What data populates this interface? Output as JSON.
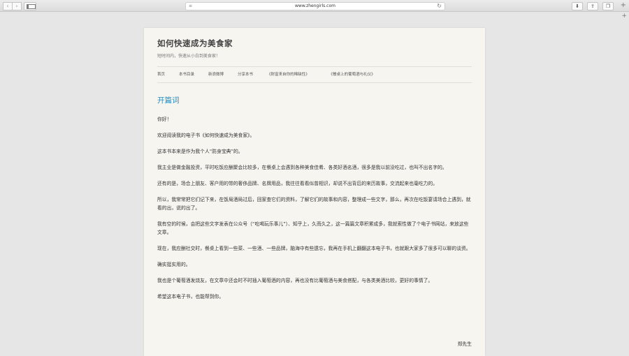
{
  "browser": {
    "url": "www.zhengirls.com",
    "back_glyph": "‹",
    "forward_glyph": "›",
    "address_menu_glyph": "≡",
    "reload_glyph": "↻",
    "download_glyph": "⬇",
    "share_glyph": "⇪",
    "tabs_glyph": "❐",
    "new_tab_glyph": "+",
    "icons": [
      "back-icon",
      "forward-icon",
      "sidebar-icon",
      "reader-icon",
      "reload-icon",
      "download-icon",
      "share-icon",
      "tabs-icon",
      "plus-icon"
    ]
  },
  "site": {
    "title": "如何快速成为美食家",
    "description": "短时间内，快速从小白到美食家！"
  },
  "menu": [
    {
      "label": "首页"
    },
    {
      "label": "本书目录"
    },
    {
      "label": "新浪微博"
    },
    {
      "label": "分享本书"
    },
    {
      "label": "《财富来自你的稀缺性》"
    },
    {
      "label": "《餐桌上的葡萄酒与礼仪》"
    }
  ],
  "article": {
    "title": "开篇词",
    "paragraphs": [
      "你好！",
      "欢迎阅读我的电子书《如何快速成为美食家》。",
      "这本书本来是作为我个人“防身宝典”的。",
      "我主业是做金融投资，平时吃饭应酬聚会比较多，在餐桌上会遇到各种美食佳肴、各类好酒名酒，很多是我以前没吃过，也叫不出名字的。",
      "还有的是，场合上朋友、客户用的带的奢侈品牌、名牌用品，我往往看看似曾相识，却说不出背后的来历故事，交流起来也毫吃力的。",
      "所以，我常常把它们记下来，在饭局酒局过后，回家查它们的资料，了解它们的故事和内容，整理成一些文字，那么，再次在吃饭宴请场合上遇到，就看的出，说的出了。",
      "我有空的时候，会把这些文字发表在公众号（“吃喝玩乐事儿”）、知乎上，久而久之，这一篇篇文章积累成多，我就索性做了个电子书网站，来放这些文章。",
      "现在，我应酬社交时，餐桌上看到一些菜、一些酒、一些品牌，脑海中有些遗忘，我再在手机上翻翻这本电子书，也就跟大家多了很多可以聊的谈资。",
      "确实挺实用的。",
      "我也是个葡萄酒发烧友，在文章中还会时不时插入葡萄酒的内容，再也没有比葡萄酒与美食搭配，与各类美酒比较，更好的事情了。",
      "希望这本电子书，也能帮到你。"
    ],
    "signature": "郑先生"
  }
}
